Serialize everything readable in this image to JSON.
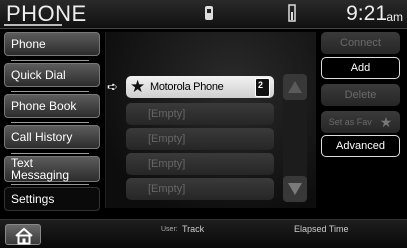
{
  "header": {
    "title": "PHONE",
    "time": "9:21",
    "ampm": "am"
  },
  "nav": {
    "items": [
      {
        "label": "Phone"
      },
      {
        "label": "Quick Dial"
      },
      {
        "label": "Phone Book"
      },
      {
        "label": "Call History"
      },
      {
        "label": "Text\nMessaging"
      },
      {
        "label": "Settings"
      }
    ],
    "active_item": "Settings"
  },
  "list": {
    "items": [
      {
        "label": "Motorola Phone",
        "selected": true,
        "icon": "star-icon"
      },
      {
        "label": "[Empty]"
      },
      {
        "label": "[Empty]"
      },
      {
        "label": "[Empty]"
      },
      {
        "label": "[Empty]"
      }
    ],
    "phone_badge": "2"
  },
  "actions": {
    "connect": "Connect",
    "add": "Add",
    "delete": "Delete",
    "set_as_fav": "Set as Fav",
    "advanced": "Advanced"
  },
  "bottom": {
    "user_label": "User:",
    "track_label": "Track",
    "elapsed_label": "Elapsed Time"
  },
  "icons": {
    "home": "home-icon",
    "scroll_up": "scroll-up-icon",
    "scroll_down": "scroll-down-icon",
    "status_1": "phone-status-icon",
    "status_2": "signal-icon"
  },
  "colors": {
    "background": "#000000",
    "button_border": "#dddddd",
    "disabled_text": "#6a6a6a"
  }
}
